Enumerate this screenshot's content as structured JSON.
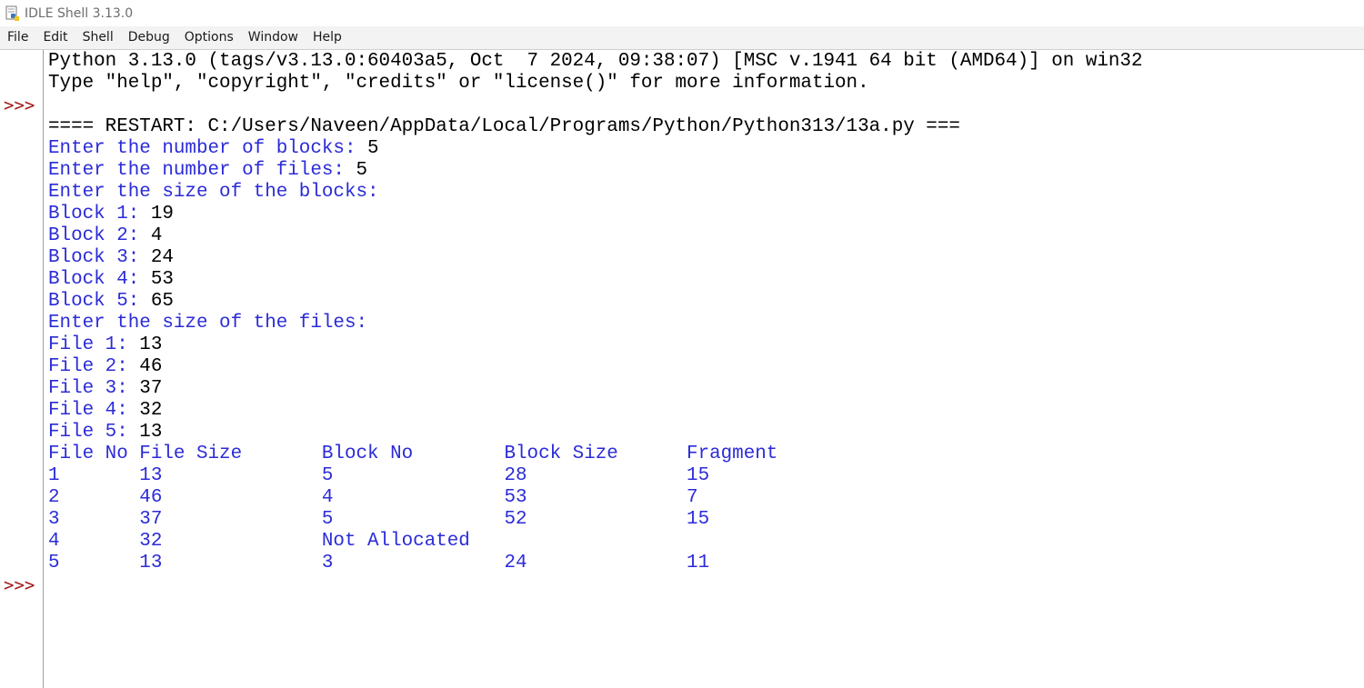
{
  "window": {
    "title": "IDLE Shell 3.13.0"
  },
  "menu": [
    "File",
    "Edit",
    "Shell",
    "Debug",
    "Options",
    "Window",
    "Help"
  ],
  "shell": {
    "prompt": ">>>",
    "banner": [
      "Python 3.13.0 (tags/v3.13.0:60403a5, Oct  7 2024, 09:38:07) [MSC v.1941 64 bit (AMD64)] on win32",
      "Type \"help\", \"copyright\", \"credits\" or \"license()\" for more information."
    ],
    "restart": "==== RESTART: C:/Users/Naveen/AppData/Local/Programs/Python/Python313/13a.py ===",
    "io": [
      {
        "prompt": "Enter the number of blocks: ",
        "value": "5"
      },
      {
        "prompt": "Enter the number of files: ",
        "value": "5"
      },
      {
        "prompt": "Enter the size of the blocks:",
        "value": ""
      },
      {
        "prompt": "Block 1: ",
        "value": "19"
      },
      {
        "prompt": "Block 2: ",
        "value": "4"
      },
      {
        "prompt": "Block 3: ",
        "value": "24"
      },
      {
        "prompt": "Block 4: ",
        "value": "53"
      },
      {
        "prompt": "Block 5: ",
        "value": "65"
      },
      {
        "prompt": "Enter the size of the files:",
        "value": ""
      },
      {
        "prompt": "File 1: ",
        "value": "13"
      },
      {
        "prompt": "File 2: ",
        "value": "46"
      },
      {
        "prompt": "File 3: ",
        "value": "37"
      },
      {
        "prompt": "File 4: ",
        "value": "32"
      },
      {
        "prompt": "File 5: ",
        "value": "13"
      }
    ],
    "table": [
      "File No File Size       Block No        Block Size      Fragment",
      "1       13              5               28              15",
      "2       46              4               53              7",
      "3       37              5               52              15",
      "4       32              Not Allocated",
      "5       13              3               24              11"
    ]
  }
}
